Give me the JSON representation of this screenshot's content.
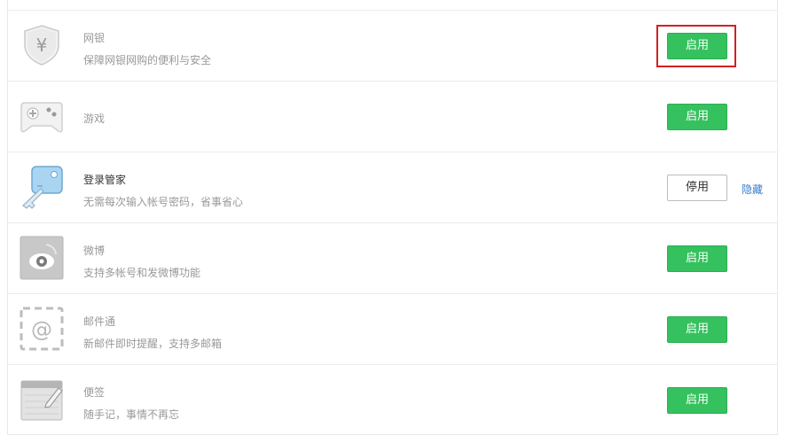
{
  "colors": {
    "enable_button_bg": "#35c15e",
    "highlight_border": "#d32020",
    "link": "#3a7dcc"
  },
  "items": [
    {
      "title": "网银",
      "desc": "保障网银网购的便利与安全",
      "icon": "shield-yen-icon",
      "button": "启用",
      "state": "disabled-feature",
      "highlighted": true
    },
    {
      "title": "游戏",
      "desc": "",
      "icon": "gamepad-icon",
      "button": "启用",
      "state": "disabled-feature"
    },
    {
      "title": "登录管家",
      "desc": "无需每次输入帐号密码，省事省心",
      "icon": "key-icon",
      "button": "停用",
      "link": "隐藏",
      "state": "enabled-feature"
    },
    {
      "title": "微博",
      "desc": "支持多帐号和发微博功能",
      "icon": "weibo-eye-icon",
      "button": "启用",
      "state": "disabled-feature"
    },
    {
      "title": "邮件通",
      "desc": "新邮件即时提醒，支持多邮箱",
      "icon": "at-mail-icon",
      "button": "启用",
      "state": "disabled-feature"
    },
    {
      "title": "便签",
      "desc": "随手记，事情不再忘",
      "icon": "notepad-icon",
      "button": "启用",
      "state": "disabled-feature"
    }
  ]
}
